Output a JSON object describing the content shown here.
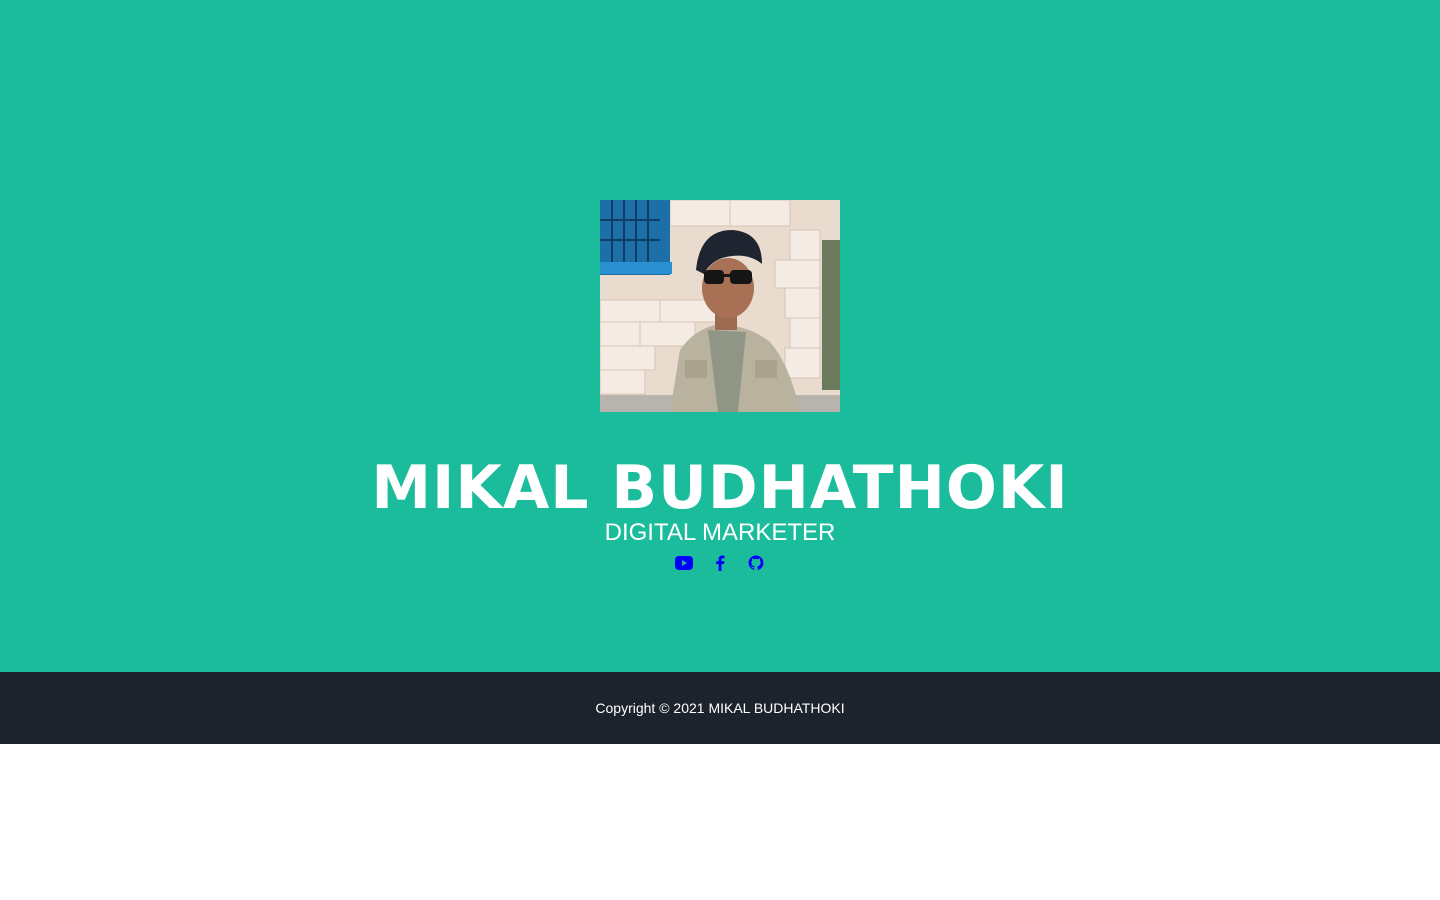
{
  "profile": {
    "name": "MIKAL BUDHATHOKI",
    "role": "DIGITAL MARKETER"
  },
  "socials": [
    {
      "icon": "youtube-icon"
    },
    {
      "icon": "facebook-icon"
    },
    {
      "icon": "github-icon"
    }
  ],
  "footer": {
    "copyright": "Copyright © 2021 MIKAL BUDHATHOKI"
  },
  "colors": {
    "hero_bg": "#1abc9c",
    "footer_bg": "#1d232d",
    "icon": "#0000ff",
    "text": "#ffffff"
  }
}
